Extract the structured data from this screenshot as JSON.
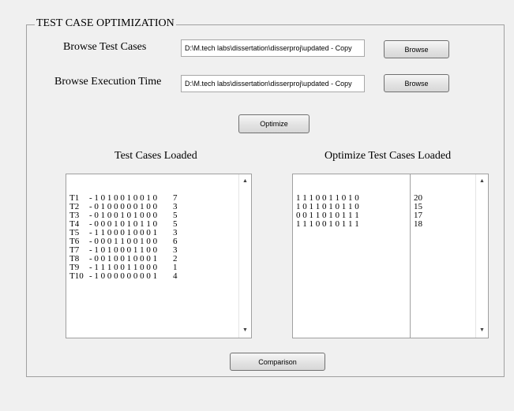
{
  "panel": {
    "title": "TEST CASE OPTIMIZATION"
  },
  "browse_test_cases": {
    "label": "Browse Test Cases",
    "path": "D:\\M.tech labs\\dissertation\\disserproj\\updated - Copy",
    "button": "Browse"
  },
  "browse_execution_time": {
    "label": "Browse Execution Time",
    "path": "D:\\M.tech labs\\dissertation\\disserproj\\updated - Copy",
    "button": "Browse"
  },
  "optimize_button": "Optimize",
  "loaded": {
    "heading": "Test Cases Loaded",
    "rows": [
      {
        "id": "T1  ",
        "bits": "- 1 0 1 0 0 1 0 0 1 0",
        "time": "7"
      },
      {
        "id": "T2  ",
        "bits": "- 0 1 0 0 0 0 0 1 0 0",
        "time": "3"
      },
      {
        "id": "T3  ",
        "bits": "- 0 1 0 0 1 0 1 0 0 0",
        "time": "5"
      },
      {
        "id": "T4  ",
        "bits": "- 0 0 0 1 0 1 0 1 1 0",
        "time": "5"
      },
      {
        "id": "T5  ",
        "bits": "- 1 1 0 0 0 1 0 0 0 1",
        "time": "3"
      },
      {
        "id": "T6  ",
        "bits": "- 0 0 0 1 1 0 0 1 0 0",
        "time": "6"
      },
      {
        "id": "T7  ",
        "bits": "- 1 0 1 0 0 0 1 1 0 0",
        "time": "3"
      },
      {
        "id": "T8  ",
        "bits": "- 0 0 1 0 0 1 0 0 0 1",
        "time": "2"
      },
      {
        "id": "T9  ",
        "bits": "- 1 1 1 0 0 1 1 0 0 0",
        "time": "1"
      },
      {
        "id": "T10 ",
        "bits": "- 1 0 0 0 0 0 0 0 0 1",
        "time": "4"
      }
    ]
  },
  "optimized": {
    "heading": "Optimize Test Cases Loaded",
    "rows": [
      {
        "bits": "1 1 1 0 0 1 1 0 1 0",
        "time": "20"
      },
      {
        "bits": "1 0 1 1 0 1 0 1 1 0",
        "time": "15"
      },
      {
        "bits": "0 0 1 1 0 1 0 1 1 1",
        "time": "17"
      },
      {
        "bits": "1 1 1 0 0 1 0 1 1 1",
        "time": "18"
      }
    ]
  },
  "comparison_button": "Comparison",
  "icons": {
    "scroll_up": "up-arrow-icon",
    "scroll_down": "down-arrow-icon"
  }
}
